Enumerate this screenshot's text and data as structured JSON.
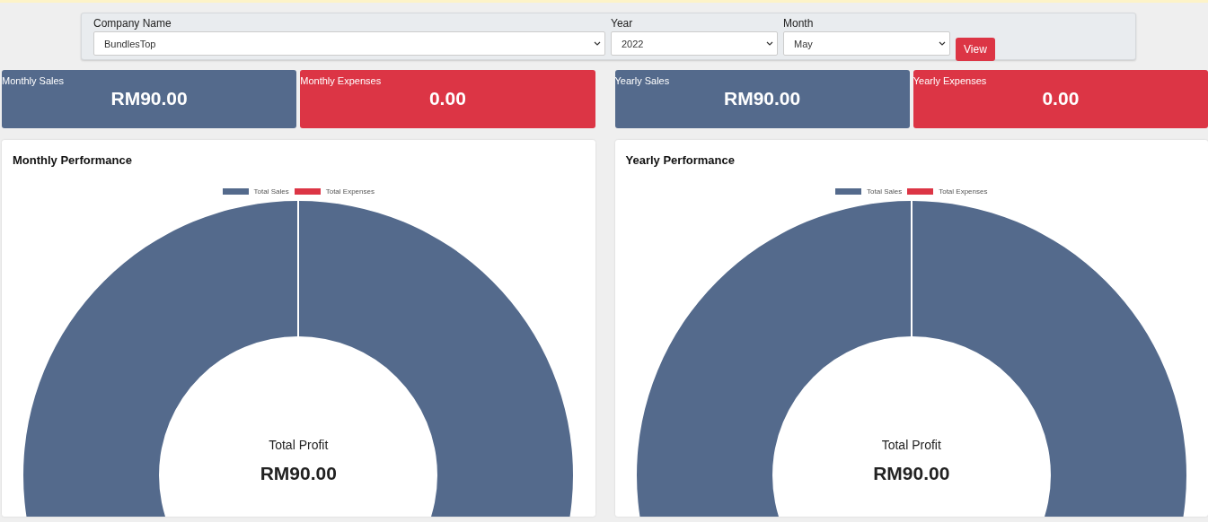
{
  "filters": [
    {
      "label": "Company Name",
      "value": "BundlesTop",
      "kind": "wide"
    },
    {
      "label": "Year",
      "value": "2022",
      "kind": "narrow"
    },
    {
      "label": "Month",
      "value": "May",
      "kind": "narrow"
    }
  ],
  "view_button": "View",
  "groups": [
    {
      "cards": [
        {
          "label": "Monthly Sales",
          "value": "RM90.00",
          "color": "#546a8c"
        },
        {
          "label": "Monthly Expenses",
          "value": "0.00",
          "color": "#dc3545"
        }
      ],
      "panel": {
        "title": "Monthly Performance",
        "center_label": "Total Profit",
        "center_value": "RM90.00",
        "legend": [
          {
            "label": "Total Sales",
            "color": "#546a8c"
          },
          {
            "label": "Total Expenses",
            "color": "#dc3545"
          }
        ]
      }
    },
    {
      "cards": [
        {
          "label": "Yearly Sales",
          "value": "RM90.00",
          "color": "#546a8c"
        },
        {
          "label": "Yearly Expenses",
          "value": "0.00",
          "color": "#dc3545"
        }
      ],
      "panel": {
        "title": "Yearly Performance",
        "center_label": "Total Profit",
        "center_value": "RM90.00",
        "legend": [
          {
            "label": "Total Sales",
            "color": "#546a8c"
          },
          {
            "label": "Total Expenses",
            "color": "#dc3545"
          }
        ]
      }
    }
  ]
}
